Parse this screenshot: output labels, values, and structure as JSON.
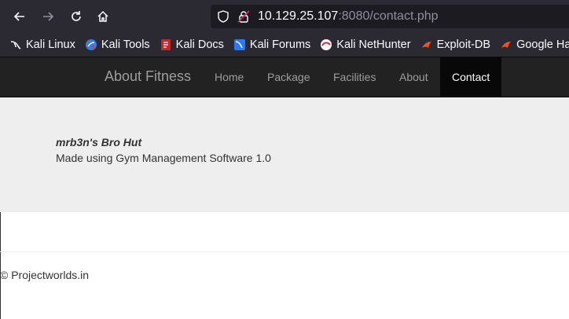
{
  "browser": {
    "url_host": "10.129.25.107",
    "url_rest": ":8080/contact.php",
    "icons": {
      "back": "back-arrow-icon",
      "forward": "forward-arrow-icon",
      "reload": "reload-icon",
      "home": "home-icon",
      "shield": "shield-icon",
      "lock": "insecure-lock-icon"
    }
  },
  "bookmarks": [
    {
      "label": "Kali Linux",
      "icon": "kali-dragon-icon"
    },
    {
      "label": "Kali Tools",
      "icon": "kali-tools-icon"
    },
    {
      "label": "Kali Docs",
      "icon": "kali-docs-icon"
    },
    {
      "label": "Kali Forums",
      "icon": "kali-forums-icon"
    },
    {
      "label": "Kali NetHunter",
      "icon": "kali-nethunter-icon"
    },
    {
      "label": "Exploit-DB",
      "icon": "exploit-db-icon"
    },
    {
      "label": "Google Ha",
      "icon": "google-hacking-icon"
    }
  ],
  "site": {
    "brand": "About Fitness",
    "nav": [
      "Home",
      "Package",
      "Facilities",
      "About",
      "Contact"
    ],
    "active": "Contact"
  },
  "main": {
    "title": "mrb3n's Bro Hut",
    "subtitle": "Made using Gym Management Software 1.0"
  },
  "footer": {
    "text": "© Projectworlds.in"
  }
}
